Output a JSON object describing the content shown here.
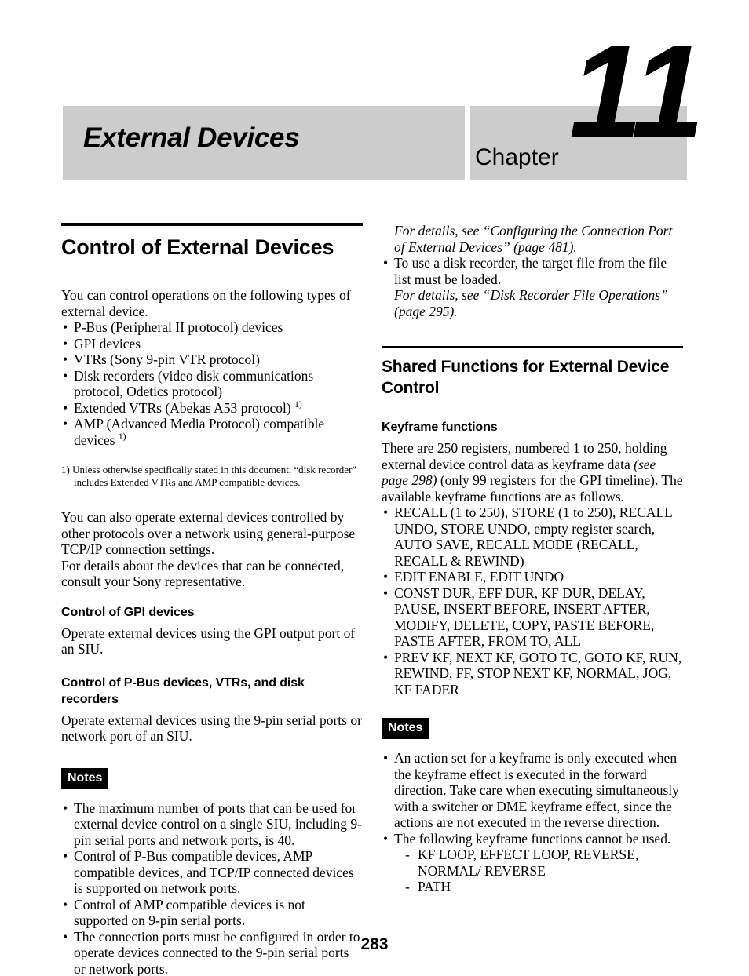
{
  "header": {
    "chapter_title": "External Devices",
    "chapter_word": "Chapter",
    "chapter_number": "11"
  },
  "left_column": {
    "section_title": "Control of External Devices",
    "intro": "You can control operations on the following types of external device.",
    "device_bullets": [
      "P-Bus (Peripheral II protocol) devices",
      "GPI devices",
      "VTRs (Sony 9-pin VTR protocol)",
      "Disk recorders (video disk communications protocol, Odetics protocol)",
      "Extended VTRs (Abekas A53 protocol)",
      "AMP (Advanced Media Protocol) compatible devices"
    ],
    "device_bullet_footnote_marks": [
      "",
      "",
      "",
      "",
      "1)",
      "1)"
    ],
    "footnote": "1) Unless otherwise specifically stated in this document, “disk recorder” includes Extended VTRs and AMP compatible devices.",
    "paragraph_network": "You can also operate external devices controlled by other protocols over a network using general-purpose TCP/IP connection settings.",
    "paragraph_consult": "For details about the devices that can be connected, consult your Sony representative.",
    "gpi_heading": "Control of GPI devices",
    "gpi_body": "Operate external devices using the GPI output port of an SIU.",
    "pbus_heading": "Control of P-Bus devices, VTRs, and disk recorders",
    "pbus_body": "Operate external devices using the 9-pin serial ports or network port of an SIU.",
    "notes_label": "Notes",
    "notes_bullets": [
      "The maximum number of ports that can be used for external device control on a single SIU, including 9-pin serial ports and network ports, is 40.",
      "Control of P-Bus compatible devices, AMP compatible devices, and TCP/IP connected devices is supported on network ports.",
      "Control of AMP compatible devices is not supported on 9-pin serial ports.",
      "The connection ports must be configured in order to operate devices connected to the 9-pin serial ports or network ports."
    ]
  },
  "right_column": {
    "continued_ref_1": "For details, see “Configuring the Connection Port of External Devices” (page 481).",
    "continued_bullet": "To use a disk recorder, the target file from the file list must be loaded.",
    "continued_ref_2": "For details, see “Disk Recorder File Operations” (page 295).",
    "section_title": "Shared Functions for External Device Control",
    "keyframe_heading": "Keyframe functions",
    "keyframe_intro_part1": "There are 250 registers, numbered 1 to 250, holding external device control data as keyframe data ",
    "keyframe_intro_italic": "(see page 298)",
    "keyframe_intro_part2": " (only 99 registers for the GPI timeline). The available keyframe functions are as follows.",
    "keyframe_bullets": [
      "RECALL (1 to 250), STORE (1 to 250), RECALL UNDO, STORE UNDO, empty register search, AUTO SAVE, RECALL MODE (RECALL, RECALL & REWIND)",
      "EDIT ENABLE, EDIT UNDO",
      "CONST DUR, EFF DUR, KF DUR, DELAY, PAUSE, INSERT BEFORE, INSERT AFTER, MODIFY, DELETE, COPY, PASTE BEFORE, PASTE AFTER, FROM TO, ALL",
      "PREV KF, NEXT KF, GOTO TC, GOTO KF, RUN, REWIND, FF, STOP NEXT KF, NORMAL, JOG, KF FADER"
    ],
    "notes_label": "Notes",
    "notes_bullets": [
      "An action set for a keyframe is only executed when the keyframe effect is executed in the forward direction. Take care when executing simultaneously with a switcher or DME keyframe effect, since the actions are not executed in the reverse direction.",
      "The following keyframe functions cannot be used."
    ],
    "cannot_use_items": [
      "KF LOOP, EFFECT LOOP, REVERSE, NORMAL/ REVERSE",
      "PATH"
    ]
  },
  "footer": {
    "page_number": "283"
  }
}
